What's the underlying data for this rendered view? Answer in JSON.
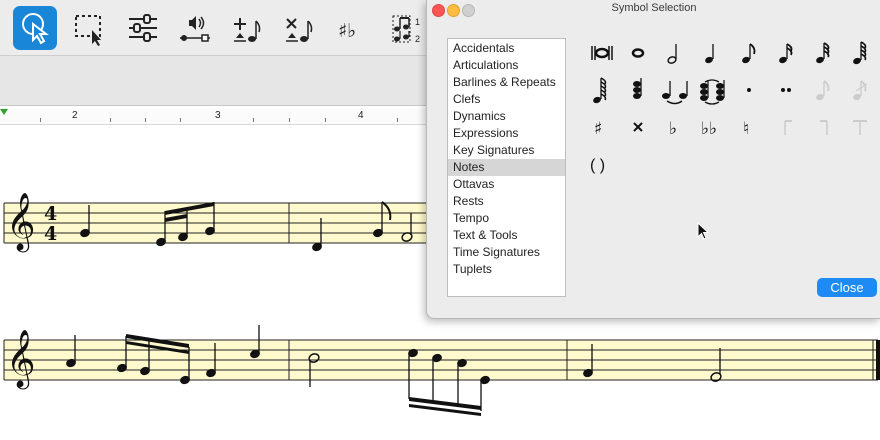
{
  "toolbar": {
    "tools": [
      {
        "name": "select-tool",
        "icon": "arrow-pointer-icon",
        "selected": true
      },
      {
        "name": "marquee-select-tool",
        "icon": "marquee-select-icon",
        "selected": false
      },
      {
        "name": "properties-tool",
        "icon": "sliders-icon",
        "selected": false
      },
      {
        "name": "playback-tool",
        "icon": "speaker-playback-icon",
        "selected": false
      },
      {
        "name": "add-note-tool",
        "icon": "add-note-icon",
        "selected": false
      },
      {
        "name": "delete-note-tool",
        "icon": "delete-note-icon",
        "selected": false
      },
      {
        "name": "accidentals-tool",
        "icon": "sharp-flat-icon",
        "selected": false
      },
      {
        "name": "voice-tool",
        "icon": "voice-notes-icon",
        "selected": false,
        "label_top": "1",
        "label_bottom": "2"
      }
    ]
  },
  "ruler": {
    "numbers": [
      "2",
      "3",
      "4"
    ]
  },
  "score": {
    "staff1": {
      "time_signature_top": "4",
      "time_signature_bottom": "4",
      "background": "#fffacd"
    },
    "staff2": {
      "background": "#fffacd"
    }
  },
  "dialog": {
    "title": "Symbol Selection",
    "categories": [
      "Accidentals",
      "Articulations",
      "Barlines & Repeats",
      "Clefs",
      "Dynamics",
      "Expressions",
      "Key Signatures",
      "Notes",
      "Ottavas",
      "Rests",
      "Tempo",
      "Text & Tools",
      "Time Signatures",
      "Tuplets"
    ],
    "selected_category": "Notes",
    "symbols": [
      "double-whole-note-icon",
      "whole-note-icon",
      "half-note-icon",
      "quarter-note-icon",
      "eighth-note-icon",
      "sixteenth-note-icon",
      "thirty-second-note-icon",
      "sixty-fourth-note-icon",
      "hundred-twenty-eighth-note-icon",
      "chord-stack-icon",
      "tied-notes-icon",
      "tied-chord-icon",
      "dot-icon",
      "double-dot-icon",
      "grace-eighth-note-icon",
      "grace-slash-note-icon",
      "sharp-icon",
      "double-sharp-icon",
      "flat-icon",
      "double-flat-icon",
      "natural-icon",
      "stem-flag-icon",
      "stem-flag-icon",
      "stem-beam-icon",
      "parentheses-icon"
    ],
    "parentheses_label": "( )",
    "close_label": "Close",
    "accent_color": "#1e8bf4"
  }
}
